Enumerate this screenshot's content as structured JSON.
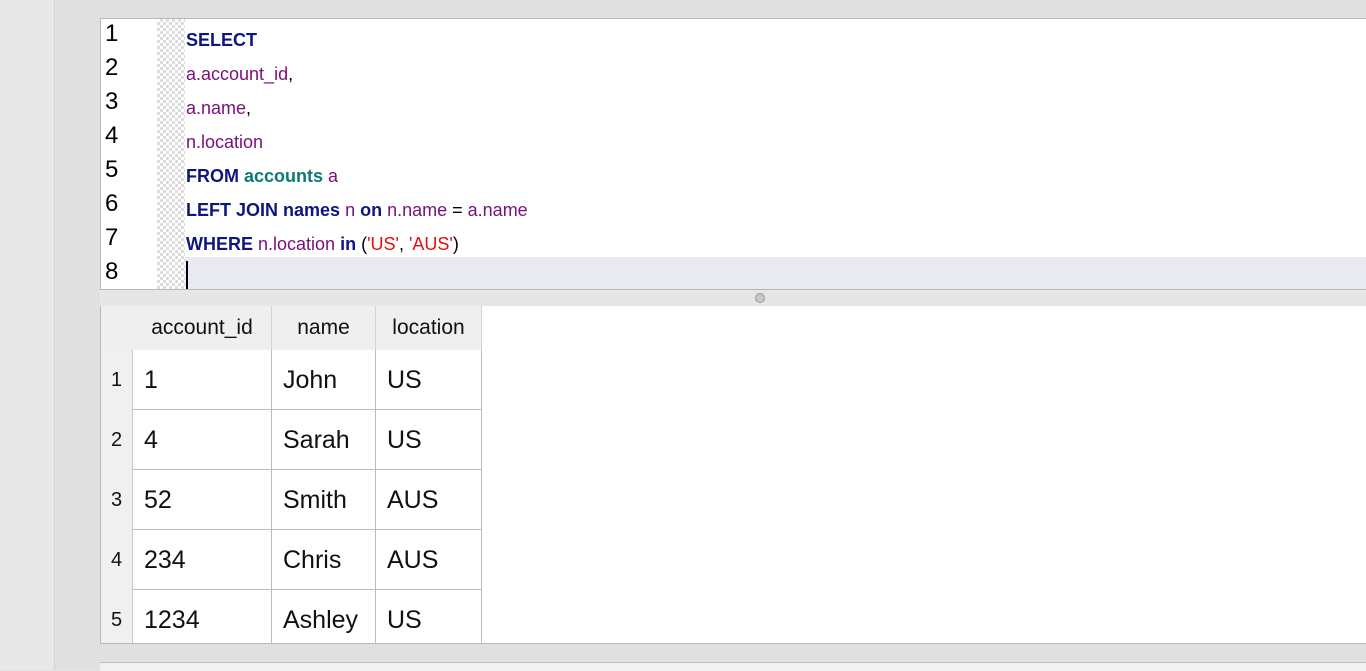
{
  "editor": {
    "line_numbers": [
      "1",
      "2",
      "3",
      "4",
      "5",
      "6",
      "7",
      "8"
    ],
    "lines": [
      [
        {
          "t": "SELECT",
          "c": "kw"
        }
      ],
      [
        {
          "t": "a.account_id",
          "c": "id"
        },
        {
          "t": ",",
          "c": "pl"
        }
      ],
      [
        {
          "t": "a.name",
          "c": "id"
        },
        {
          "t": ",",
          "c": "pl"
        }
      ],
      [
        {
          "t": "n.location",
          "c": "id"
        }
      ],
      [
        {
          "t": "FROM",
          "c": "kw"
        },
        {
          "t": " ",
          "c": "pl"
        },
        {
          "t": "accounts",
          "c": "tbl"
        },
        {
          "t": " a",
          "c": "id"
        }
      ],
      [
        {
          "t": "LEFT JOIN",
          "c": "kw"
        },
        {
          "t": " ",
          "c": "pl"
        },
        {
          "t": "names",
          "c": "kw"
        },
        {
          "t": " n ",
          "c": "id"
        },
        {
          "t": "on",
          "c": "kw"
        },
        {
          "t": " n.name",
          "c": "id"
        },
        {
          "t": " = ",
          "c": "pl"
        },
        {
          "t": "a.name",
          "c": "id"
        }
      ],
      [
        {
          "t": "WHERE",
          "c": "kw"
        },
        {
          "t": " n.location ",
          "c": "id"
        },
        {
          "t": "in",
          "c": "kw"
        },
        {
          "t": " (",
          "c": "pl"
        },
        {
          "t": "'US'",
          "c": "str"
        },
        {
          "t": ", ",
          "c": "pl"
        },
        {
          "t": "'AUS'",
          "c": "str"
        },
        {
          "t": ")",
          "c": "pl"
        }
      ],
      []
    ]
  },
  "results": {
    "columns": [
      "account_id",
      "name",
      "location"
    ],
    "rows": [
      {
        "num": "1",
        "cells": [
          "1",
          "John",
          "US"
        ]
      },
      {
        "num": "2",
        "cells": [
          "4",
          "Sarah",
          "US"
        ]
      },
      {
        "num": "3",
        "cells": [
          "52",
          "Smith",
          "AUS"
        ]
      },
      {
        "num": "4",
        "cells": [
          "234",
          "Chris",
          "AUS"
        ]
      },
      {
        "num": "5",
        "cells": [
          "1234",
          "Ashley",
          "US"
        ]
      }
    ]
  }
}
